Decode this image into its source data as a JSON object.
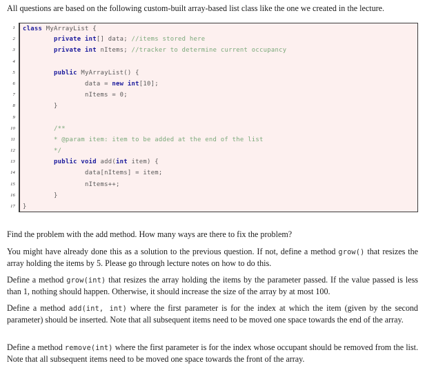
{
  "document": {
    "intro": "All questions are based on the following custom-built array-based list class like the one we created in the lecture.",
    "code_listing": {
      "language": "Java",
      "background_color": "#fdf0ef",
      "border_color": "#3a3a3a",
      "keyword_color": "#1a1a9c",
      "comment_color": "#7aa87a",
      "identifier_color": "#585858",
      "lines": [
        {
          "n": "1",
          "text": "class MyArrayList {"
        },
        {
          "n": "2",
          "text": "        private int[] data; //items stored here"
        },
        {
          "n": "3",
          "text": "        private int nItems; //tracker to determine current occupancy"
        },
        {
          "n": "4",
          "text": ""
        },
        {
          "n": "5",
          "text": "        public MyArrayList() {"
        },
        {
          "n": "6",
          "text": "                data = new int[10];"
        },
        {
          "n": "7",
          "text": "                nItems = 0;"
        },
        {
          "n": "8",
          "text": "        }"
        },
        {
          "n": "9",
          "text": ""
        },
        {
          "n": "10",
          "text": "        /**"
        },
        {
          "n": "11",
          "text": "        * @param item: item to be added at the end of the list"
        },
        {
          "n": "12",
          "text": "        */"
        },
        {
          "n": "13",
          "text": "        public void add(int item) {"
        },
        {
          "n": "14",
          "text": "                data[nItems] = item;"
        },
        {
          "n": "15",
          "text": "                nItems++;"
        },
        {
          "n": "16",
          "text": "        }"
        },
        {
          "n": "17",
          "text": "}"
        }
      ]
    },
    "paragraphs": {
      "p1": "Find the problem with the add method. How many ways are there to fix the problem?",
      "p2_a": "You might have already done this as a solution to the previous question.  If not, define a method ",
      "p2_code": "grow()",
      "p2_b": " that resizes the array holding the items by 5. Please go through lecture notes on how to do this.",
      "p3_a": "Define a method ",
      "p3_code": "grow(int)",
      "p3_b": " that resizes the array holding the items by the parameter passed. If the value passed is less than 1, nothing should happen. Otherwise, it should increase the size of the array by at most 100.",
      "p4_a": "Define a method ",
      "p4_code": "add(int, int)",
      "p4_b": " where the first parameter is for the index at which the item (given by the second parameter) should be inserted. Note that all subsequent items need to be moved one space towards the end of the array.",
      "p5_a": "Define a method ",
      "p5_code": "remove(int)",
      "p5_b": " where the first parameter is for the index whose occupant should be removed from the list. Note that all subsequent items need to be moved one space towards the front of the array."
    }
  }
}
